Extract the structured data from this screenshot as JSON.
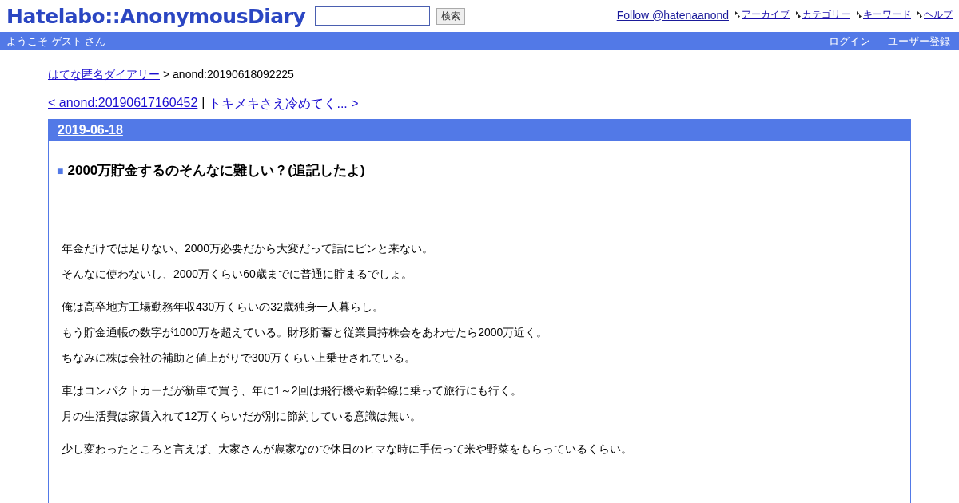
{
  "header": {
    "logo": "Hatelabo::AnonymousDiary",
    "search": {
      "button": "検索"
    },
    "follow_link": "Follow @hatenaanond",
    "nav_links": [
      "アーカイブ",
      "カテゴリー",
      "キーワード",
      "ヘルプ"
    ]
  },
  "user_bar": {
    "welcome": "ようこそ ゲスト さん",
    "links": [
      "ログイン",
      "ユーザー登録"
    ]
  },
  "breadcrumb": {
    "link": "はてな匿名ダイアリー",
    "current": "> anond:20190618092225"
  },
  "pager": {
    "prev": "< anond:20190617160452",
    "separator": "|",
    "next": "トキメキさえ冷めてく... >"
  },
  "entry": {
    "date": "2019-06-18",
    "marker": "■",
    "title": "2000万貯金するのそんなに難しい？(追記したよ)",
    "paragraph_groups": [
      [
        "年金だけでは足りない、2000万必要だから大変だって話にピンと来ない。",
        "そんなに使わないし、2000万くらい60歳までに普通に貯まるでしょ。"
      ],
      [
        "俺は高卒地方工場勤務年収430万くらいの32歳独身一人暮らし。",
        "もう貯金通帳の数字が1000万を超えている。財形貯蓄と従業員持株会をあわせたら2000万近く。",
        "ちなみに株は会社の補助と値上がりで300万くらい上乗せされている。"
      ],
      [
        "車はコンパクトカーだが新車で買う、年に1～2回は飛行機や新幹線に乗って旅行にも行く。",
        "月の生活費は家賃入れて12万くらいだが別に節約している意識は無い。"
      ],
      [
        "少し変わったところと言えば、大家さんが農家なので休日のヒマな時に手伝って米や野菜をもらっているくらい。"
      ]
    ]
  }
}
